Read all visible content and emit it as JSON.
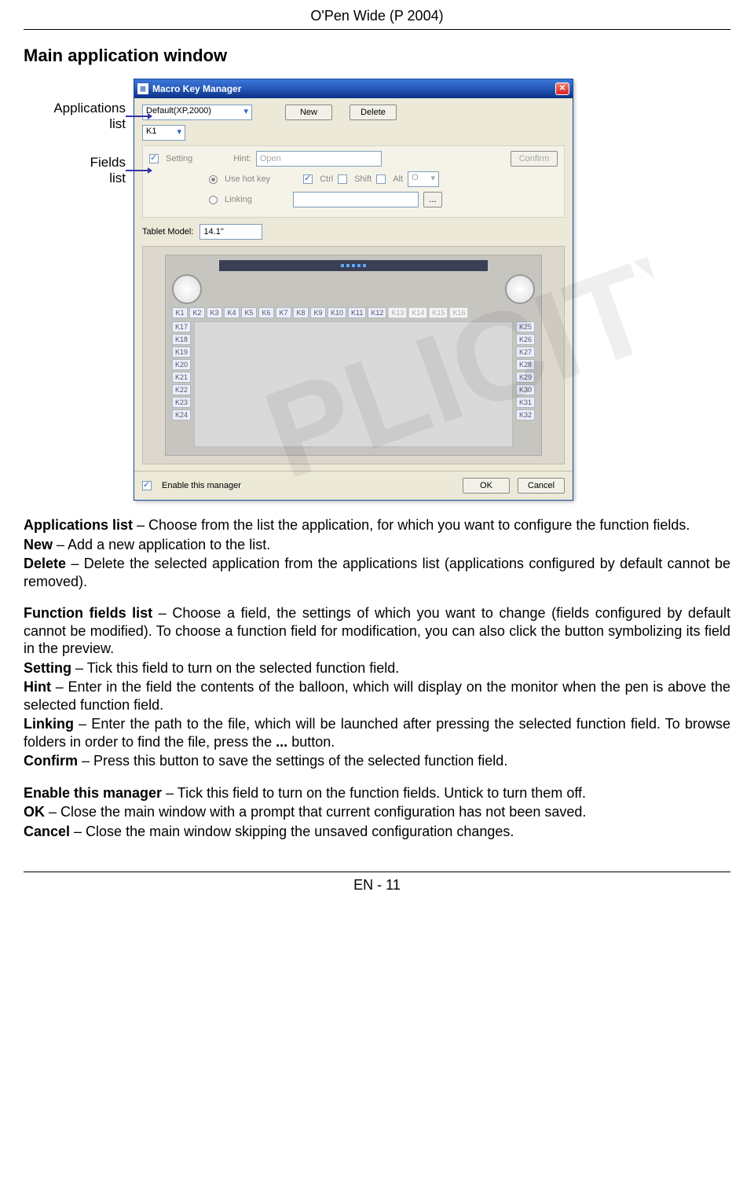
{
  "header": "O'Pen Wide (P 2004)",
  "footer": "EN - 11",
  "section_title": "Main application window",
  "callouts": {
    "apps_l1": "Applications",
    "apps_l2": "list",
    "fields_l1": "Fields",
    "fields_l2": "list"
  },
  "win": {
    "title": "Macro Key Manager",
    "app_select": "Default(XP,2000)",
    "new_btn": "New",
    "delete_btn": "Delete",
    "field_select": "K1",
    "setting_label": "Setting",
    "hint_label": "Hint:",
    "hint_value": "Open",
    "confirm_btn": "Confirm",
    "usehotkey_label": "Use hot key",
    "ctrl_label": "Ctrl",
    "shift_label": "Shift",
    "alt_label": "Alt",
    "hotkey_value": "O",
    "linking_label": "Linking",
    "browse_btn": "...",
    "tablet_model_label": "Tablet Model:",
    "tablet_model_value": "14.1\"",
    "krow_top": [
      "K1",
      "K2",
      "K3",
      "K4",
      "K5",
      "K6",
      "K7",
      "K8",
      "K9",
      "K10",
      "K11",
      "K12",
      "K13",
      "K14",
      "K15",
      "K16"
    ],
    "krow_left": [
      "K17",
      "K18",
      "K19",
      "K20",
      "K21",
      "K22",
      "K23",
      "K24"
    ],
    "krow_right": [
      "K25",
      "K26",
      "K27",
      "K28",
      "K29",
      "K30",
      "K31",
      "K32"
    ],
    "enable_label": "Enable this manager",
    "ok_btn": "OK",
    "cancel_btn": "Cancel"
  },
  "body": {
    "p1a": "Applications list",
    "p1b": " – Choose from the list the application, for which you want to configure the function fields.",
    "p2a": "New",
    "p2b": " – Add a new application to the list.",
    "p3a": "Delete",
    "p3b": " – Delete the selected application from the applications list (applications configured by default cannot be removed).",
    "p4a": "Function fields list",
    "p4b": " – Choose a field, the settings of which you want to change (fields configured by default cannot be modified). To choose a function field for modification, you can also click the button symbolizing its field in the preview.",
    "p5a": "Setting",
    "p5b": " – Tick this field to turn on the selected function field.",
    "p6a": "Hint",
    "p6b": " – Enter in the field the contents of the balloon, which will display on the monitor when the pen is above the selected function field.",
    "p7a": "Linking",
    "p7b": " – Enter the path to the file, which will be launched after pressing the selected function field. To browse folders in order to find the file, press the ",
    "p7c": "...",
    "p7d": " button.",
    "p8a": "Confirm",
    "p8b": " – Press this button to save the settings of the selected function field.",
    "p9a": "Enable this manager",
    "p9b": " – Tick this field to turn on the function fields. Untick to turn them off.",
    "p10a": "OK",
    "p10b": " – Close the main window with a prompt that current configuration has not been saved.",
    "p11a": "Cancel",
    "p11b": " – Close the main window skipping the unsaved configuration changes."
  }
}
